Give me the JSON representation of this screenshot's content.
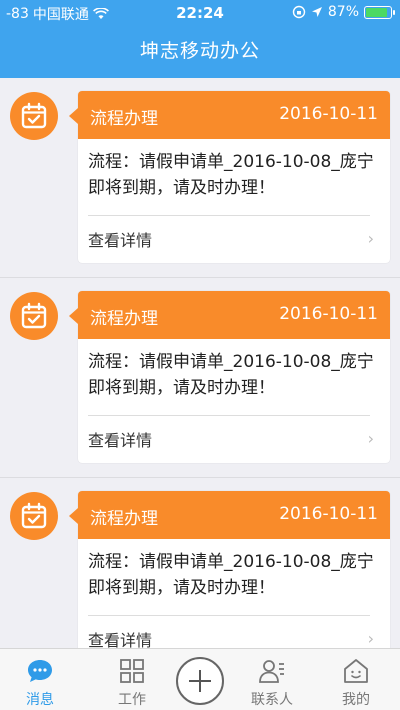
{
  "status_bar": {
    "signal": "-83",
    "carrier": "中国联通",
    "time": "22:24",
    "battery": "87%",
    "battery_level": 0.87
  },
  "header": {
    "title": "坤志移动办公"
  },
  "messages": [
    {
      "label": "流程办理",
      "date": "2016-10-11",
      "body": "流程：请假申请单_2016-10-08_庞宁 即将到期，请及时办理！",
      "detail": "查看详情"
    },
    {
      "label": "流程办理",
      "date": "2016-10-11",
      "body": "流程：请假申请单_2016-10-08_庞宁 即将到期，请及时办理！",
      "detail": "查看详情"
    },
    {
      "label": "流程办理",
      "date": "2016-10-11",
      "body": "流程：请假申请单_2016-10-08_庞宁 即将到期，请及时办理！",
      "detail": "查看详情"
    }
  ],
  "tabbar": {
    "messages": "消息",
    "work": "工作",
    "contacts": "联系人",
    "mine": "我的"
  },
  "colors": {
    "header": "#3fa4ee",
    "accent_orange": "#f98b2a",
    "tab_active": "#2f9be8"
  }
}
